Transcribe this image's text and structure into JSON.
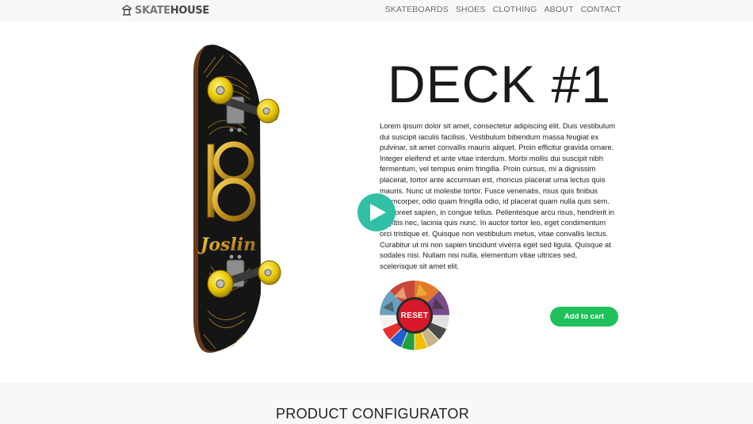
{
  "header": {
    "logo_text_primary": "SKATE",
    "logo_text_secondary": "HOUSE",
    "logo_icon": "shop-icon",
    "nav": [
      {
        "label": "SKATEBOARDS"
      },
      {
        "label": "SHOES"
      },
      {
        "label": "CLOTHING"
      },
      {
        "label": "ABOUT"
      },
      {
        "label": "CONTACT"
      }
    ]
  },
  "product": {
    "title": "DECK #1",
    "description": "Lorem ipsum dolor sit amet, consectetur adipiscing elit. Duis vestibulum dui suscipit iaculis facilisis. Vestibulum bibendum massa feugiat ex pulvinar, sit amet convallis mauris aliquet. Proin efficitur gravida ornare. Integer eleifend et ante vitae interdum. Morbi mollis dui suscipit nibh fermentum, vel tempus enim fringilla. Proin cursus, mi a dignissim placerat, tortor ante accumsan est, rhoncus placerat urna lectus quis mauris. Nunc ut molestie tortor. Fusce venenatis, risus quis finibus ullamcorper, odio quam fringilla odio, id placerat quam nulla quis sem. Ut laoreet sapien, in congue tellus. Pellentesque arcu risus, hendrerit in sagittis nec, lacinia quis nunc. In auctor tortor leo, eget condimentum orci tristique et. Quisque non vestibulum metus, vitae convallis lectus. Curabitur ut mi non sapien tincidunt viverra eget sed ligula. Quisque at sodales nisi. Nullam nisi nulla, elementum vitae ultrices sed, scelerisque sit amet elit.",
    "deck_brand_text": "Joslin",
    "reset_label": "RESET",
    "add_to_cart_label": "Add to cart",
    "play_icon": "play-icon"
  },
  "colors": {
    "play_button": "#2fc0a5",
    "add_to_cart": "#1fc05a",
    "reset": "#d8182a",
    "deck_gold": "#d4a62a",
    "deck_black": "#151515"
  },
  "swatches": [
    "#e0e0e0",
    "#4a4a4a",
    "#c8b48a",
    "#f0c000",
    "#20a040",
    "#1f5fd0",
    "#e83030",
    "#f2f2f2"
  ],
  "configurator": {
    "title": "PRODUCT CONFIGURATOR"
  }
}
